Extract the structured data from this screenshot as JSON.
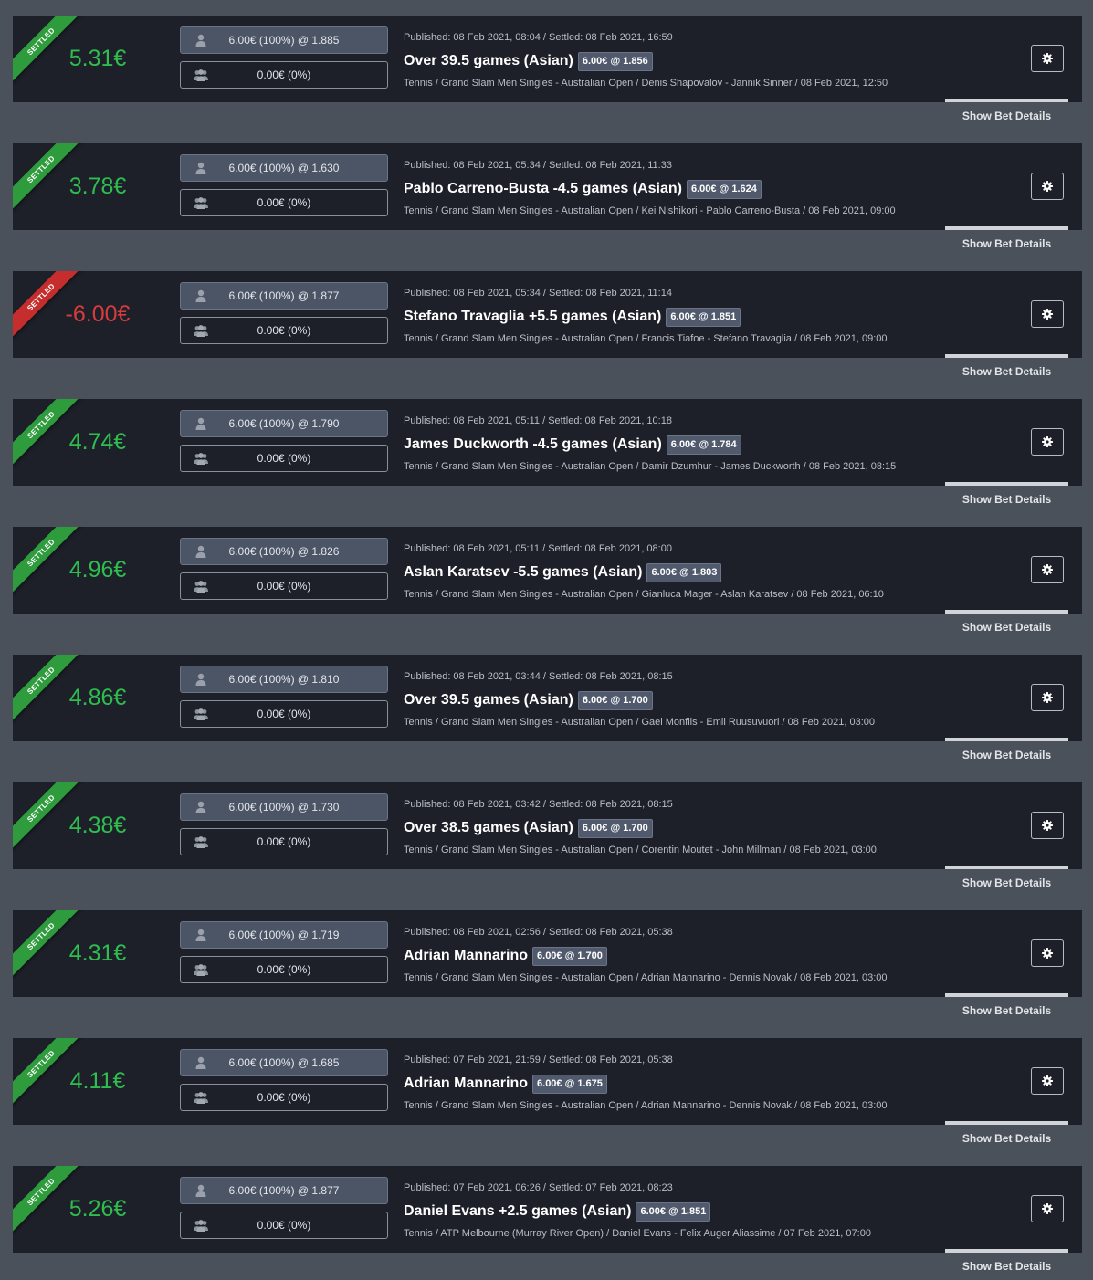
{
  "ui": {
    "details_label": "Show Bet Details",
    "colors": {
      "background": "#4a515b",
      "card": "#1d2029",
      "won": "#2fbd4f",
      "lost": "#d63c3c",
      "ribbon_won": "#2e9c3c",
      "ribbon_lost": "#c62d2d"
    },
    "icons": {
      "own_stake": "user-icon",
      "followers_stake": "users-icon",
      "settings": "gear-icon"
    }
  },
  "bets": [
    {
      "status": "SETTLED",
      "result": "won",
      "profit": "5.31€",
      "own_stake": "6.00€ (100%) @ 1.885",
      "followers_stake": "0.00€ (0%)",
      "published": "Published: 08 Feb 2021, 08:04 / Settled: 08 Feb 2021, 16:59",
      "title": "Over 39.5 games (Asian)",
      "odds_badge": "6.00€ @ 1.856",
      "event": "Tennis / Grand Slam Men Singles - Australian Open / Denis Shapovalov - Jannik Sinner / 08 Feb 2021, 12:50"
    },
    {
      "status": "SETTLED",
      "result": "won",
      "profit": "3.78€",
      "own_stake": "6.00€ (100%) @ 1.630",
      "followers_stake": "0.00€ (0%)",
      "published": "Published: 08 Feb 2021, 05:34 / Settled: 08 Feb 2021, 11:33",
      "title": "Pablo Carreno-Busta -4.5 games (Asian)",
      "odds_badge": "6.00€ @ 1.624",
      "event": "Tennis / Grand Slam Men Singles - Australian Open / Kei Nishikori - Pablo Carreno-Busta / 08 Feb 2021, 09:00"
    },
    {
      "status": "SETTLED",
      "result": "lost",
      "profit": "-6.00€",
      "own_stake": "6.00€ (100%) @ 1.877",
      "followers_stake": "0.00€ (0%)",
      "published": "Published: 08 Feb 2021, 05:34 / Settled: 08 Feb 2021, 11:14",
      "title": "Stefano Travaglia +5.5 games (Asian)",
      "odds_badge": "6.00€ @ 1.851",
      "event": "Tennis / Grand Slam Men Singles - Australian Open / Francis Tiafoe - Stefano Travaglia / 08 Feb 2021, 09:00"
    },
    {
      "status": "SETTLED",
      "result": "won",
      "profit": "4.74€",
      "own_stake": "6.00€ (100%) @ 1.790",
      "followers_stake": "0.00€ (0%)",
      "published": "Published: 08 Feb 2021, 05:11 / Settled: 08 Feb 2021, 10:18",
      "title": "James Duckworth -4.5 games (Asian)",
      "odds_badge": "6.00€ @ 1.784",
      "event": "Tennis / Grand Slam Men Singles - Australian Open / Damir Dzumhur - James Duckworth / 08 Feb 2021, 08:15"
    },
    {
      "status": "SETTLED",
      "result": "won",
      "profit": "4.96€",
      "own_stake": "6.00€ (100%) @ 1.826",
      "followers_stake": "0.00€ (0%)",
      "published": "Published: 08 Feb 2021, 05:11 / Settled: 08 Feb 2021, 08:00",
      "title": "Aslan Karatsev -5.5 games (Asian)",
      "odds_badge": "6.00€ @ 1.803",
      "event": "Tennis / Grand Slam Men Singles - Australian Open / Gianluca Mager - Aslan Karatsev / 08 Feb 2021, 06:10"
    },
    {
      "status": "SETTLED",
      "result": "won",
      "profit": "4.86€",
      "own_stake": "6.00€ (100%) @ 1.810",
      "followers_stake": "0.00€ (0%)",
      "published": "Published: 08 Feb 2021, 03:44 / Settled: 08 Feb 2021, 08:15",
      "title": "Over 39.5 games (Asian)",
      "odds_badge": "6.00€ @ 1.700",
      "event": "Tennis / Grand Slam Men Singles - Australian Open / Gael Monfils - Emil Ruusuvuori / 08 Feb 2021, 03:00"
    },
    {
      "status": "SETTLED",
      "result": "won",
      "profit": "4.38€",
      "own_stake": "6.00€ (100%) @ 1.730",
      "followers_stake": "0.00€ (0%)",
      "published": "Published: 08 Feb 2021, 03:42 / Settled: 08 Feb 2021, 08:15",
      "title": "Over 38.5 games (Asian)",
      "odds_badge": "6.00€ @ 1.700",
      "event": "Tennis / Grand Slam Men Singles - Australian Open / Corentin Moutet - John Millman / 08 Feb 2021, 03:00"
    },
    {
      "status": "SETTLED",
      "result": "won",
      "profit": "4.31€",
      "own_stake": "6.00€ (100%) @ 1.719",
      "followers_stake": "0.00€ (0%)",
      "published": "Published: 08 Feb 2021, 02:56 / Settled: 08 Feb 2021, 05:38",
      "title": "Adrian Mannarino",
      "odds_badge": "6.00€ @ 1.700",
      "event": "Tennis / Grand Slam Men Singles - Australian Open / Adrian Mannarino - Dennis Novak / 08 Feb 2021, 03:00"
    },
    {
      "status": "SETTLED",
      "result": "won",
      "profit": "4.11€",
      "own_stake": "6.00€ (100%) @ 1.685",
      "followers_stake": "0.00€ (0%)",
      "published": "Published: 07 Feb 2021, 21:59 / Settled: 08 Feb 2021, 05:38",
      "title": "Adrian Mannarino",
      "odds_badge": "6.00€ @ 1.675",
      "event": "Tennis / Grand Slam Men Singles - Australian Open / Adrian Mannarino - Dennis Novak / 08 Feb 2021, 03:00"
    },
    {
      "status": "SETTLED",
      "result": "won",
      "profit": "5.26€",
      "own_stake": "6.00€ (100%) @ 1.877",
      "followers_stake": "0.00€ (0%)",
      "published": "Published: 07 Feb 2021, 06:26 / Settled: 07 Feb 2021, 08:23",
      "title": "Daniel Evans +2.5 games (Asian)",
      "odds_badge": "6.00€ @ 1.851",
      "event": "Tennis / ATP Melbourne (Murray River Open) / Daniel Evans - Felix Auger Aliassime / 07 Feb 2021, 07:00"
    }
  ]
}
